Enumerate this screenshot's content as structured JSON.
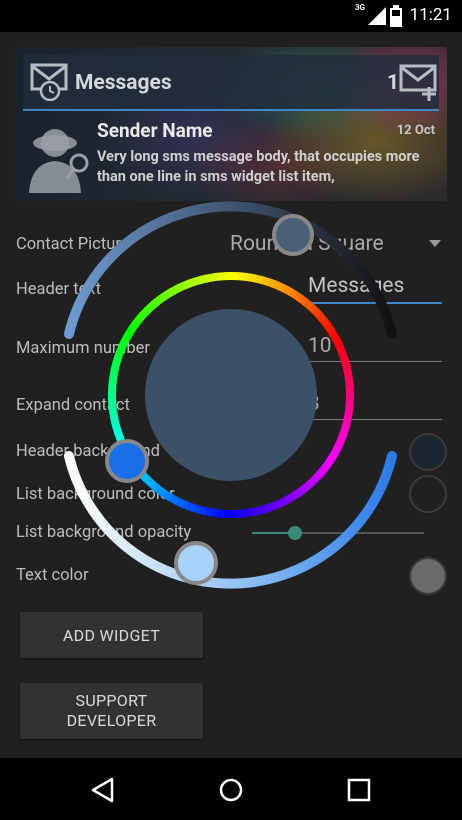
{
  "status_bar": {
    "network": "3G",
    "time": "11:21",
    "icons": [
      "signal-icon",
      "battery-icon"
    ]
  },
  "widget_preview": {
    "title": "Messages",
    "count": "1",
    "sender": "Sender Name",
    "date": "12 Oct",
    "body": "Very long sms message body, that occupies more than one line in sms widget list item,",
    "icons": [
      "message-clock-icon",
      "new-message-icon",
      "contact-silhouette-icon"
    ]
  },
  "settings": {
    "contact_picture": {
      "label": "Contact Picture",
      "value": "Rounded Square"
    },
    "header_text": {
      "label": "Header text",
      "value": "Messages"
    },
    "max_number": {
      "label": "Maximum number",
      "value": "10"
    },
    "expand_contact": {
      "label": "Expand contact",
      "value": "3"
    },
    "header_bg": {
      "label": "Header background",
      "color": "#1a2530"
    },
    "list_bg": {
      "label": "List background color",
      "color": "#202020"
    },
    "list_opacity": {
      "label": "List background opacity",
      "value_fraction": 0.25
    },
    "text_color": {
      "label": "Text color",
      "color": "#6a6a6a"
    }
  },
  "buttons": {
    "add_widget": "ADD WIDGET",
    "support_line1": "SUPPORT",
    "support_line2": "DEVELOPER"
  },
  "color_picker": {
    "selected_color": "#3c5068",
    "hue_handle_color": "#1a6fe8",
    "saturation_handle_color": "#4a6078",
    "value_handle_color": "#a9d2fa"
  },
  "nav_bar": {
    "icons": [
      "back-icon",
      "home-icon",
      "recents-icon"
    ]
  },
  "colors": {
    "accent": "#3d86c8",
    "background": "#202020"
  }
}
